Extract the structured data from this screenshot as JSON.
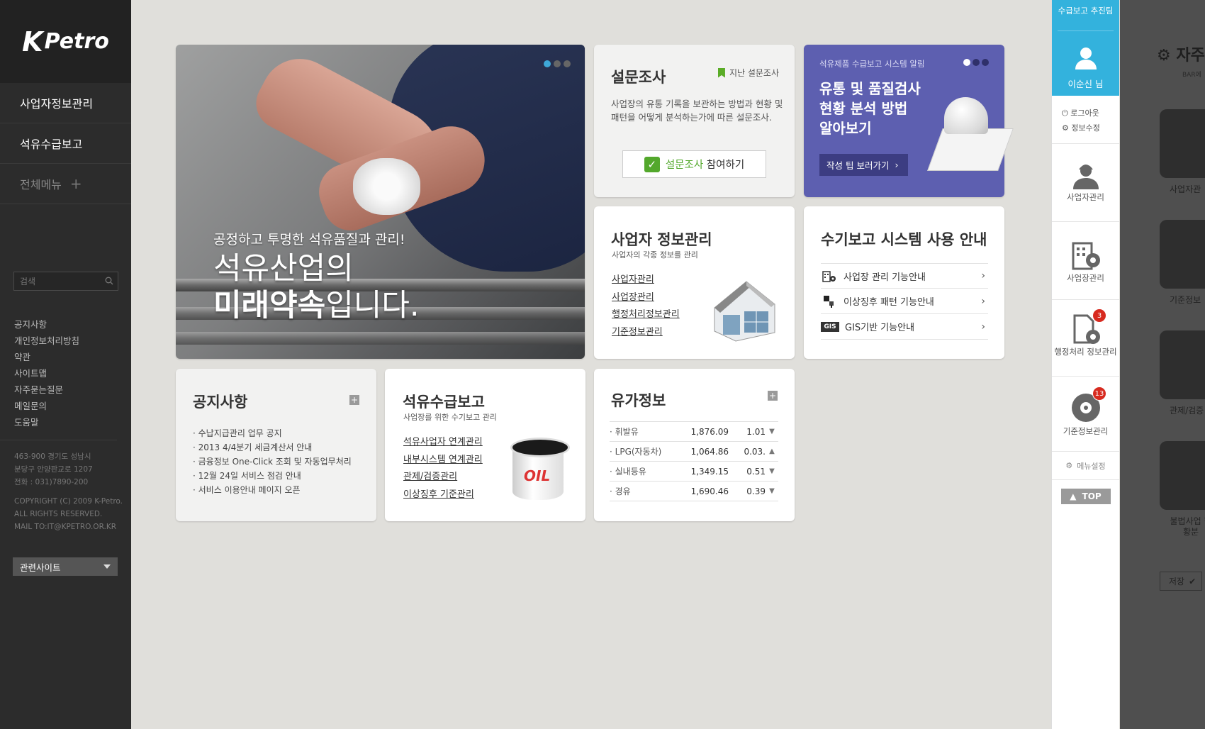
{
  "brand": {
    "logo_k": "K",
    "logo_text": "Petro"
  },
  "sidebar": {
    "nav": [
      {
        "label": "사업자정보관리"
      },
      {
        "label": "석유수급보고"
      },
      {
        "label": "전체메뉴"
      }
    ],
    "all_menu_plus": "+",
    "search_placeholder": "검색",
    "links": [
      "공지사항",
      "개인정보처리방침",
      "약관",
      "사이트맵",
      "자주묻는질문",
      "메일문의",
      "도움말"
    ],
    "address": [
      "463-900 경기도 성남시",
      "분당구 안양판교로 1207",
      "전화 : 031)7890-200"
    ],
    "copyright": [
      "COPYRIGHT (C) 2009 K-Petro.",
      "ALL RIGHTS RESERVED.",
      "MAIL TO:IT@KPETRO.OR.KR"
    ],
    "related_sites": "관련사이트"
  },
  "hero": {
    "subtitle": "공정하고 투명한 석유품질과 관리!",
    "line1": "석유산업의",
    "line2_bold": "미래약속",
    "line2_rest": "입니다."
  },
  "survey": {
    "title": "설문조사",
    "past_link": "지난 설문조사",
    "desc": "사업장의 유통 기록을 보관하는 방법과 현황 및 패턴을 어떻게 분석하는가에 따른 설문조사.",
    "button_green": "설문조사",
    "button_rest": "참여하기"
  },
  "promo": {
    "tag": "석유제품 수급보고 시스템 알림",
    "headline": [
      "유통 및 품질검사",
      "현황 분석 방법",
      "알아보기"
    ],
    "tip_button": "작성 팁 보러가기"
  },
  "bizinfo": {
    "title": "사업자 정보관리",
    "subtitle": "사업자의 각종 정보를 관리",
    "links": [
      "사업자관리",
      "사업장관리",
      "행정처리정보관리",
      "기준정보관리"
    ]
  },
  "guide": {
    "title": "수기보고 시스템 사용 안내",
    "items": [
      "사업장 관리 기능안내",
      "이상징후 패턴 기능안내",
      "GIS기반 기능안내"
    ],
    "gis_label": "GIS"
  },
  "notice": {
    "title": "공지사항",
    "items": [
      "수납지급관리 업무 공지",
      "2013 4/4분기 세금계산서 안내",
      "금융정보 One-Click 조회 및 자동업무처리",
      "12월 24일 서비스 점검 안내",
      "서비스 이용안내 페이지 오픈"
    ]
  },
  "oil_report": {
    "title": "석유수급보고",
    "subtitle": "사업장를 위한 수기보고 관리",
    "links": [
      "석유사업자 연계관리",
      "내부시스템 연계관리",
      "관제/검증관리",
      "이상징후 기준관리"
    ],
    "bucket_label": "OIL"
  },
  "price": {
    "title": "유가정보",
    "rows": [
      {
        "name": "휘발유",
        "value": "1,876.09",
        "change": "1.01",
        "dir": "down"
      },
      {
        "name": "LPG(자동차)",
        "value": "1,064.86",
        "change": "0.03.",
        "dir": "up"
      },
      {
        "name": "실내등유",
        "value": "1,349.15",
        "change": "0.51",
        "dir": "down"
      },
      {
        "name": "경유",
        "value": "1,690.46",
        "change": "0.39",
        "dir": "down"
      }
    ]
  },
  "rpanel": {
    "team": "수급보고 추진팀",
    "user": "이순신 님",
    "logout": "로그아웃",
    "edit": "정보수정",
    "items": [
      {
        "label": "사업자관리"
      },
      {
        "label": "사업장관리"
      },
      {
        "label": "행정처리 정보관리",
        "badge": "3"
      },
      {
        "label": "기준정보관리",
        "badge": "13"
      }
    ],
    "menu_setting": "메뉴설정",
    "top": "TOP"
  },
  "overlay": {
    "title": "자주",
    "subtitle": "BAR에",
    "labels": [
      "사업자관",
      "기준정보",
      "관제/검증",
      "불법사업 현황분"
    ],
    "save": "저장"
  }
}
